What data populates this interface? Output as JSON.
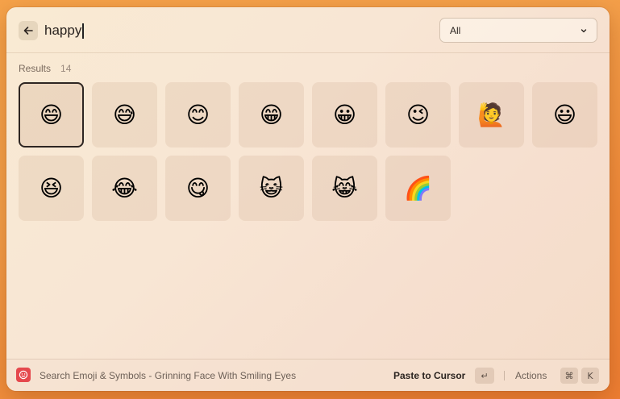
{
  "search": {
    "query": "happy",
    "back_icon": "arrow-left-icon"
  },
  "filter": {
    "selected": "All",
    "icon": "chevron-down-icon"
  },
  "results": {
    "label": "Results",
    "count": "14",
    "items": [
      {
        "emoji": "😄",
        "name": "Grinning Face With Smiling Eyes",
        "selected": true
      },
      {
        "emoji": "😅",
        "name": "Grinning Face With Sweat"
      },
      {
        "emoji": "😊",
        "name": "Smiling Face With Smiling Eyes"
      },
      {
        "emoji": "😁",
        "name": "Beaming Face With Smiling Eyes"
      },
      {
        "emoji": "😀",
        "name": "Grinning Face"
      },
      {
        "emoji": "😉",
        "name": "Winking Face"
      },
      {
        "emoji": "🙋",
        "name": "Person Raising Hand"
      },
      {
        "emoji": "😃",
        "name": "Grinning Face With Big Eyes"
      },
      {
        "emoji": "😆",
        "name": "Grinning Squinting Face"
      },
      {
        "emoji": "😂",
        "name": "Face With Tears of Joy"
      },
      {
        "emoji": "😋",
        "name": "Face Savoring Food"
      },
      {
        "emoji": "😺",
        "name": "Grinning Cat"
      },
      {
        "emoji": "😹",
        "name": "Cat With Tears of Joy"
      },
      {
        "emoji": "🌈",
        "name": "Rainbow"
      }
    ]
  },
  "footer": {
    "app_icon": "emoji-smile-icon",
    "title": "Search Emoji & Symbols - Grinning Face With Smiling Eyes",
    "primary_action": "Paste to Cursor",
    "primary_shortcut": "↵",
    "actions_label": "Actions",
    "actions_shortcut_mod": "⌘",
    "actions_shortcut_key": "K"
  }
}
